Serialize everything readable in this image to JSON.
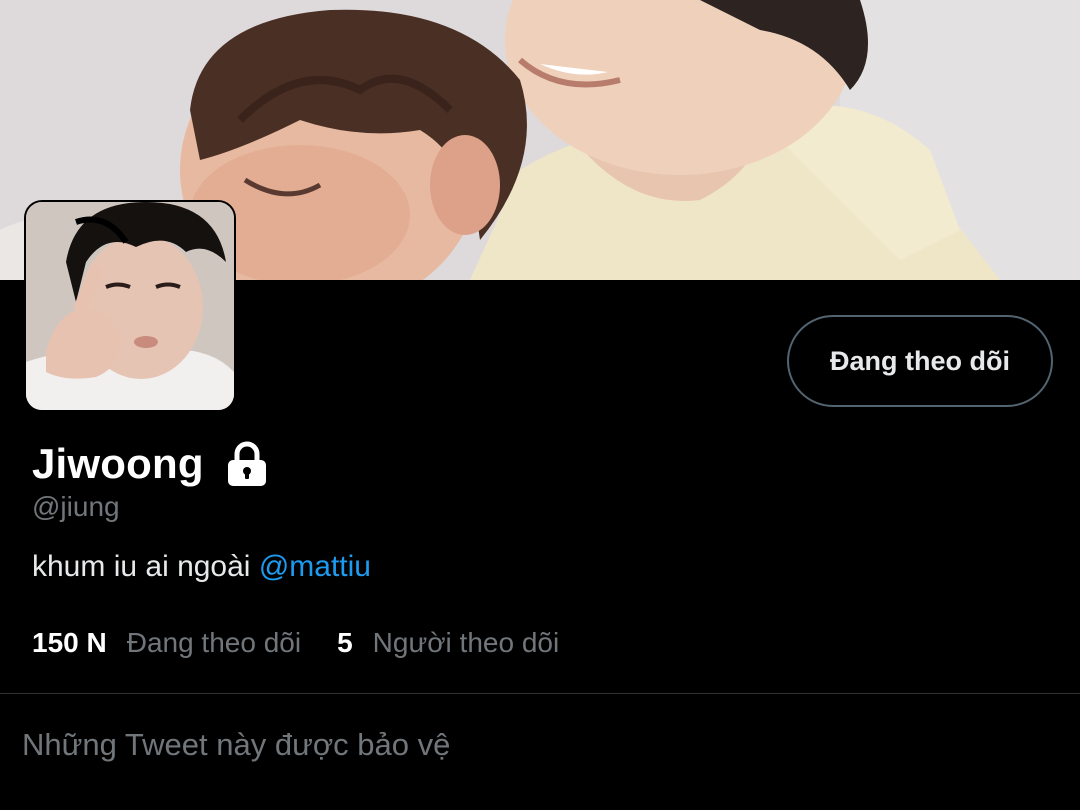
{
  "profile": {
    "display_name": "Jiwoong",
    "handle": "@jiung",
    "bio_text": "khum iu ai ngoài ",
    "bio_mention": "@mattiu",
    "follow_button_label": "Đang theo dõi",
    "is_protected": true
  },
  "stats": {
    "following_count": "150 N",
    "following_label": "Đang theo dõi",
    "followers_count": "5",
    "followers_label": "Người theo dõi"
  },
  "feed": {
    "protected_message": "Những Tweet này được bảo vệ"
  },
  "icons": {
    "lock": "lock-icon"
  },
  "colors": {
    "background": "#000000",
    "accent": "#1d9bf0",
    "secondary_text": "#71767b",
    "primary_text": "#e7e9ea",
    "button_border": "#536471"
  }
}
